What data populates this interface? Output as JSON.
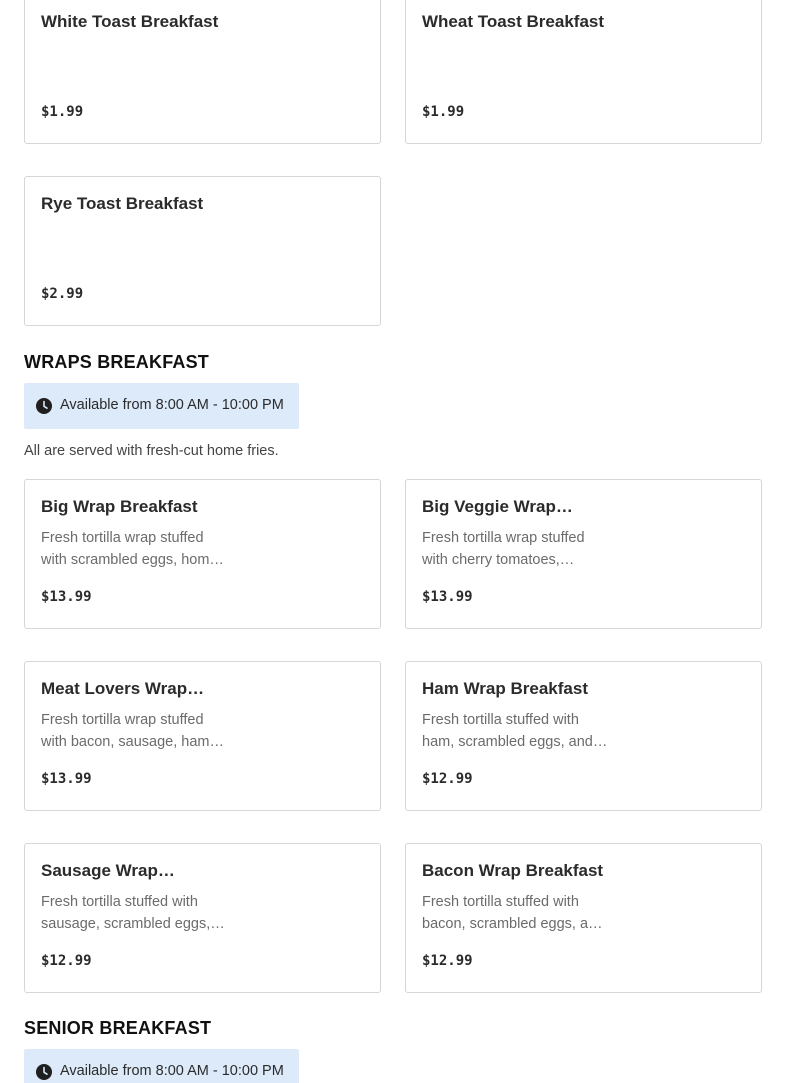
{
  "toast_items": [
    {
      "name": "White Toast Breakfast",
      "desc1": "",
      "desc2": "",
      "price": "$1.99"
    },
    {
      "name": "Wheat Toast Breakfast",
      "desc1": "",
      "desc2": "",
      "price": "$1.99"
    },
    {
      "name": "Rye Toast Breakfast",
      "desc1": "",
      "desc2": "",
      "price": "$2.99"
    }
  ],
  "wraps_section": {
    "title": "WRAPS BREAKFAST",
    "availability": "Available from 8:00 AM - 10:00 PM",
    "note": "All are served with fresh-cut home fries.",
    "items": [
      {
        "name": "Big Wrap Breakfast",
        "desc1": "Fresh tortilla wrap stuffed",
        "desc2": "with scrambled eggs, hom…",
        "price": "$13.99"
      },
      {
        "name": "Big Veggie Wrap…",
        "desc1": "Fresh tortilla wrap stuffed",
        "desc2": "with cherry tomatoes,…",
        "price": "$13.99"
      },
      {
        "name": "Meat Lovers Wrap…",
        "desc1": "Fresh tortilla wrap stuffed",
        "desc2": "with bacon, sausage, ham…",
        "price": "$13.99"
      },
      {
        "name": "Ham Wrap Breakfast",
        "desc1": "Fresh tortilla stuffed with",
        "desc2": "ham, scrambled eggs, and…",
        "price": "$12.99"
      },
      {
        "name": "Sausage Wrap…",
        "desc1": "Fresh tortilla stuffed with",
        "desc2": "sausage, scrambled eggs,…",
        "price": "$12.99"
      },
      {
        "name": "Bacon Wrap Breakfast",
        "desc1": "Fresh tortilla stuffed with",
        "desc2": "bacon, scrambled eggs, a…",
        "price": "$12.99"
      }
    ]
  },
  "senior_section": {
    "title": "SENIOR BREAKFAST",
    "availability": "Available from 8:00 AM - 10:00 PM"
  },
  "icons": {
    "clock": "clock-icon"
  },
  "colors": {
    "availability_bg": "#dceaf9",
    "card_border": "#d6d6d6",
    "description_text": "#6b6b6b"
  }
}
